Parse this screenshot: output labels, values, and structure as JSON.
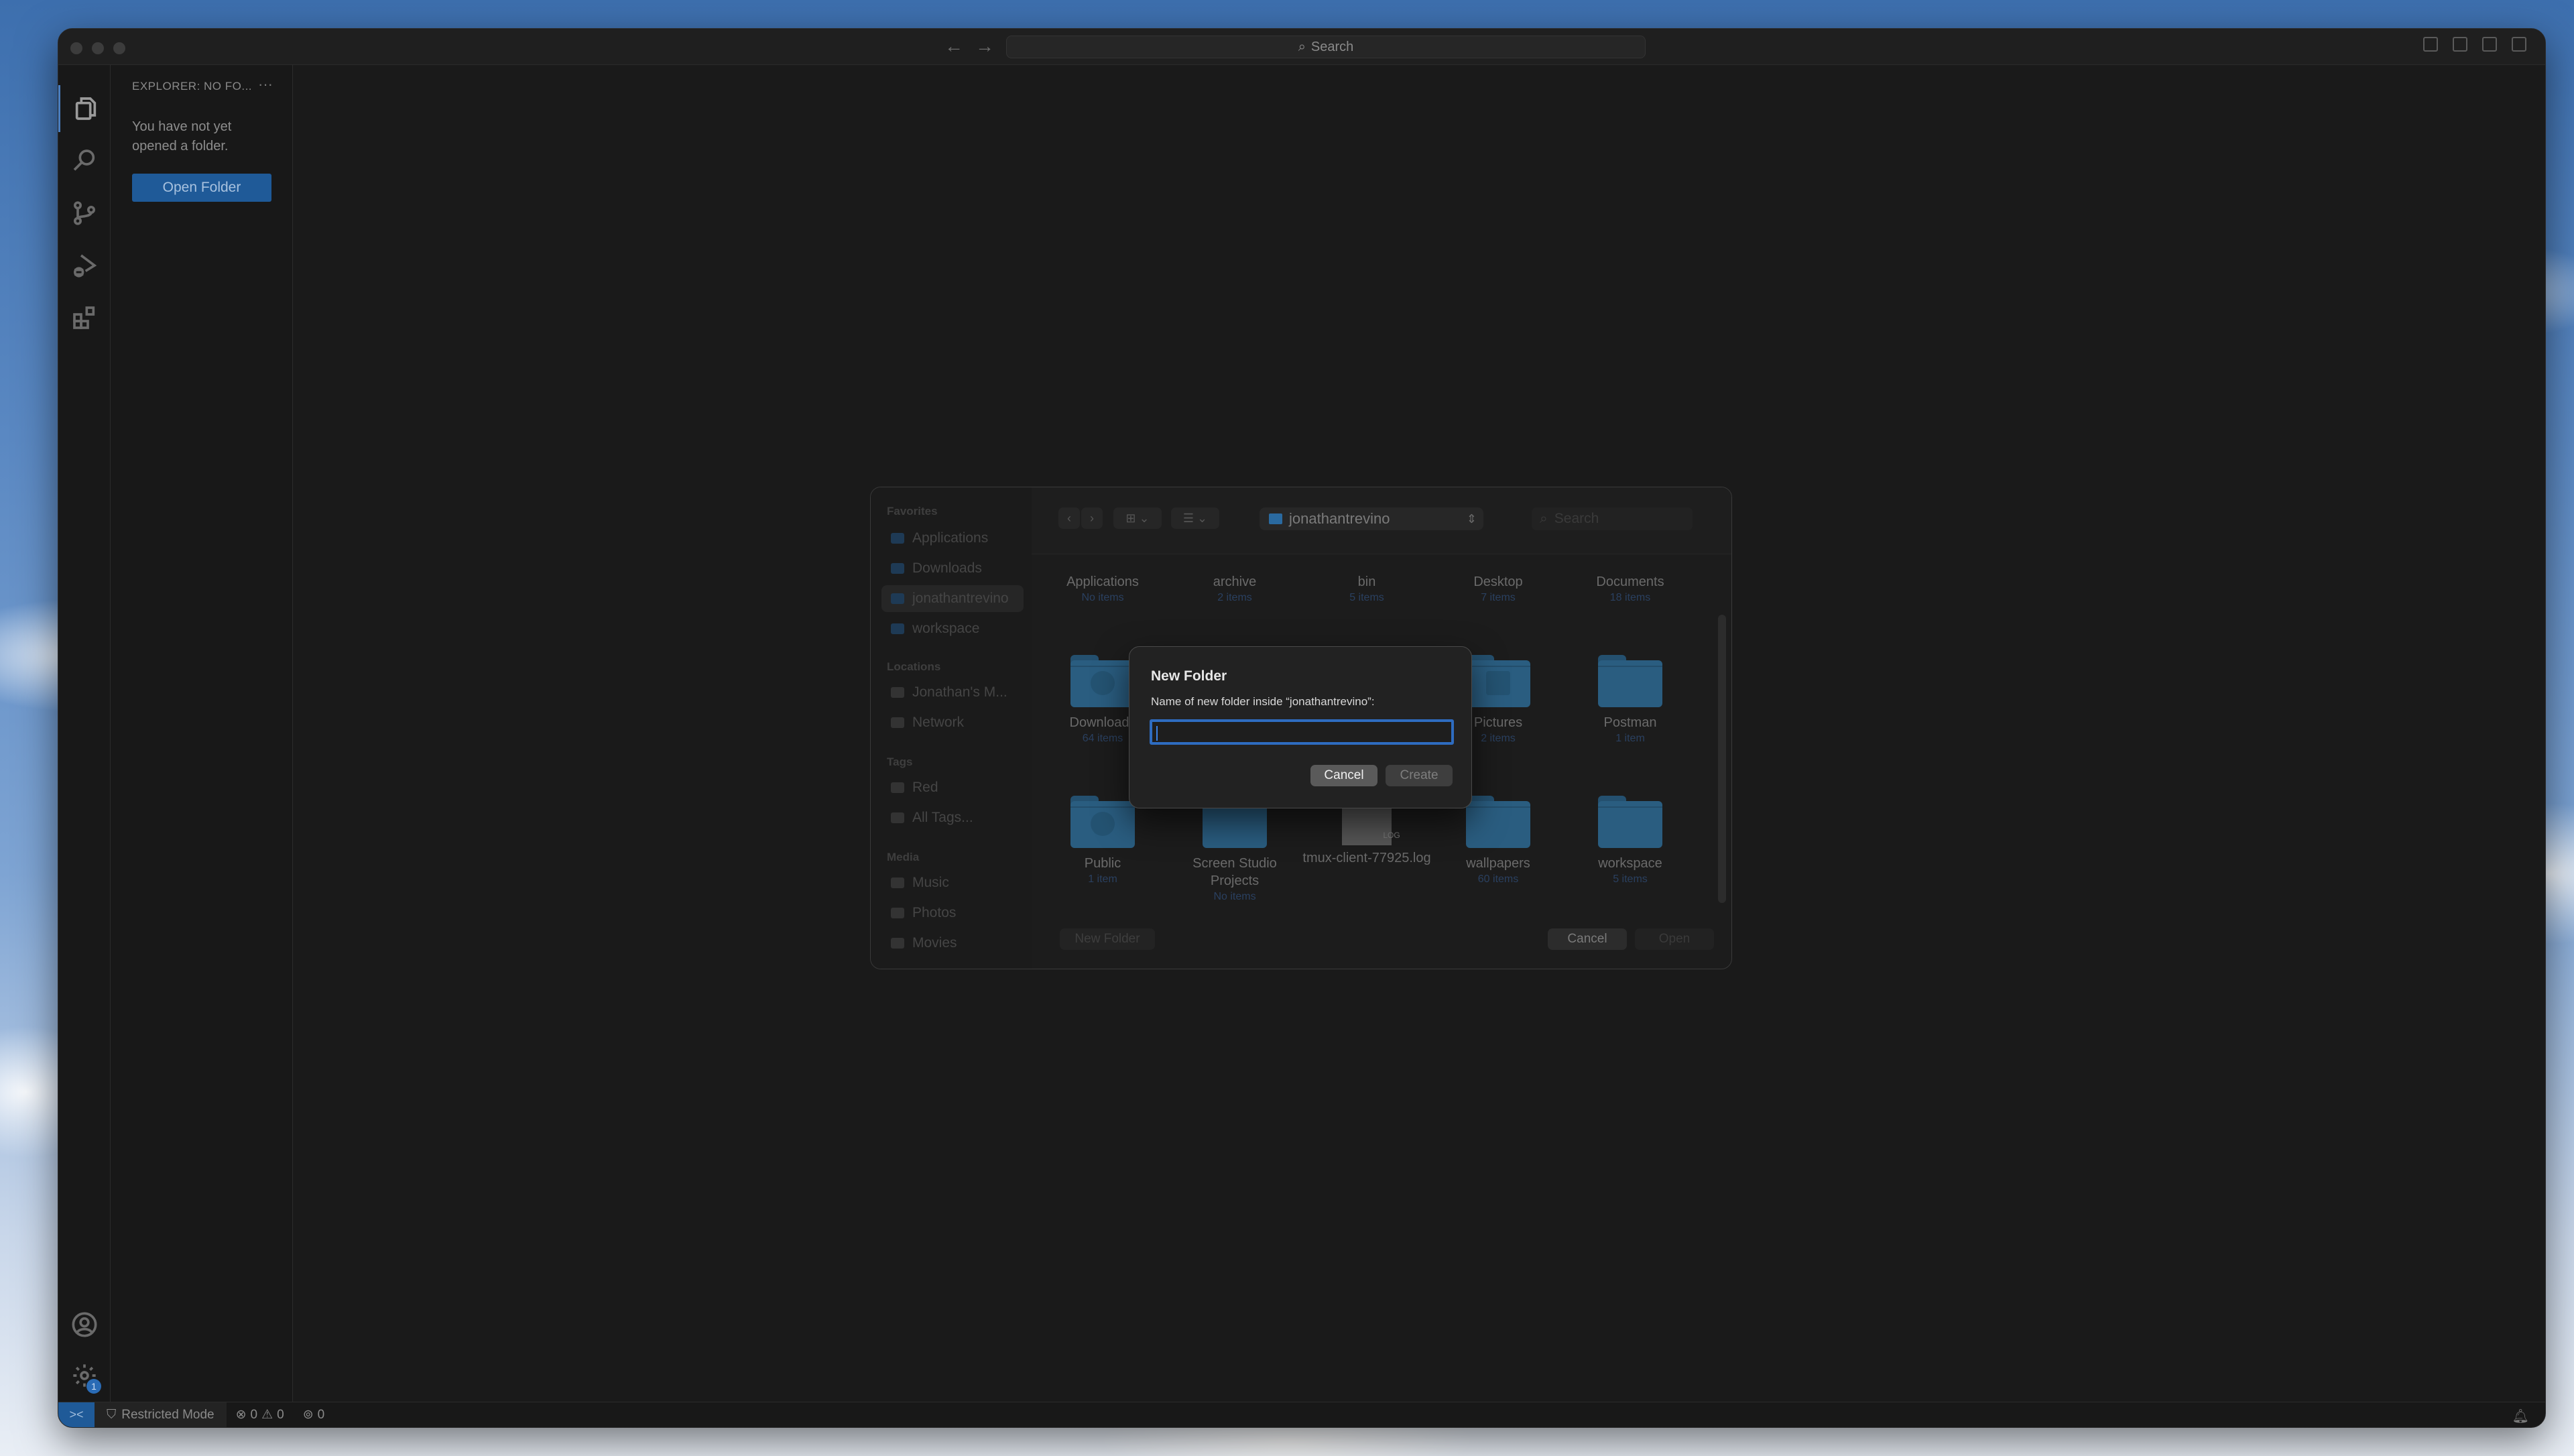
{
  "titlebar": {
    "search_placeholder": "Search",
    "back_icon": "arrow-left-icon",
    "forward_icon": "arrow-right-icon"
  },
  "activitybar": {
    "items": [
      {
        "id": "explorer",
        "icon": "files-icon",
        "active": true
      },
      {
        "id": "search",
        "icon": "search-icon"
      },
      {
        "id": "source-control",
        "icon": "source-control-icon"
      },
      {
        "id": "run-debug",
        "icon": "run-debug-icon"
      },
      {
        "id": "extensions",
        "icon": "extensions-icon"
      }
    ],
    "bottom": [
      {
        "id": "accounts",
        "icon": "account-icon"
      },
      {
        "id": "manage",
        "icon": "gear-icon",
        "badge": "1"
      }
    ]
  },
  "sidebar": {
    "title": "EXPLORER: NO FO...",
    "more": "···",
    "message": "You have not yet opened a folder.",
    "open_folder_label": "Open Folder"
  },
  "statusbar": {
    "remote_icon": "remote-icon",
    "restricted_mode": "Restricted Mode",
    "errors": "0",
    "warnings": "0",
    "ports": "0"
  },
  "open_dialog": {
    "sidebar": {
      "sections": [
        {
          "title": "Favorites",
          "items": [
            "Applications",
            "Downloads",
            "jonathantrevino",
            "workspace"
          ],
          "selected": "jonathantrevino"
        },
        {
          "title": "Locations",
          "items": [
            "Jonathan's M...",
            "Network"
          ]
        },
        {
          "title": "Tags",
          "items": [
            "Red",
            "All Tags..."
          ]
        },
        {
          "title": "Media",
          "items": [
            "Music",
            "Photos",
            "Movies"
          ]
        }
      ]
    },
    "path": "jonathantrevino",
    "search_placeholder": "Search",
    "items": [
      {
        "name": "Applications",
        "count": "No items"
      },
      {
        "name": "archive",
        "count": "2 items"
      },
      {
        "name": "bin",
        "count": "5 items"
      },
      {
        "name": "Desktop",
        "count": "7 items"
      },
      {
        "name": "Documents",
        "count": "18 items"
      },
      {
        "name": "Downloads",
        "count": "64 items"
      },
      {
        "name": "",
        "count": ""
      },
      {
        "name": "",
        "count": ""
      },
      {
        "name": "Pictures",
        "count": "2 items"
      },
      {
        "name": "Postman",
        "count": "1 item"
      },
      {
        "name": "Public",
        "count": "1 item"
      },
      {
        "name": "Screen Studio Projects",
        "count": "No items"
      },
      {
        "name": "tmux-client-77925.log",
        "count": ""
      },
      {
        "name": "wallpapers",
        "count": "60 items"
      },
      {
        "name": "workspace",
        "count": "5 items"
      }
    ],
    "new_folder_label": "New Folder",
    "cancel_label": "Cancel",
    "open_label": "Open"
  },
  "new_folder_sheet": {
    "title": "New Folder",
    "prompt": "Name of new folder inside “jonathantrevino”:",
    "value": "",
    "cancel_label": "Cancel",
    "create_label": "Create",
    "focus_color": "#2e6cc0"
  }
}
